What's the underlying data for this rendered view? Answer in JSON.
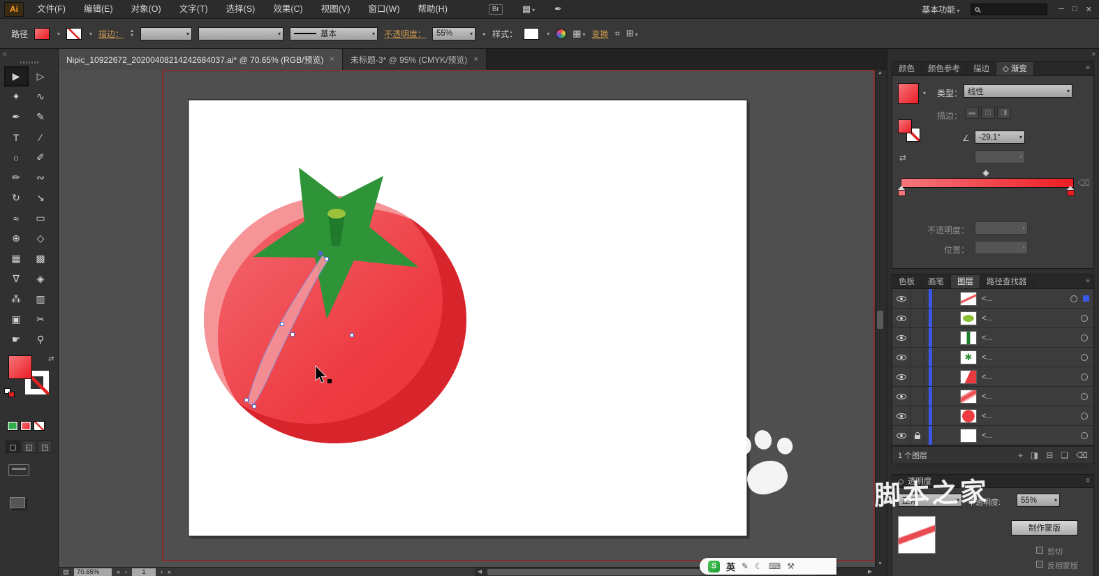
{
  "titlebar": {
    "logo": "Ai",
    "menus": [
      "文件(F)",
      "编辑(E)",
      "对象(O)",
      "文字(T)",
      "选择(S)",
      "效果(C)",
      "视图(V)",
      "窗口(W)",
      "帮助(H)"
    ],
    "bridge": "Br",
    "arrange_icon": "▦",
    "cslive_icon": "✒",
    "workspace": "基本功能",
    "window": {
      "minimize": "─",
      "restore": "□",
      "close": "✕"
    }
  },
  "control_bar": {
    "selection_type": "路径",
    "stroke_link": "描边：",
    "stroke_style": "基本",
    "opacity_link": "不透明度：",
    "opacity_value": "55%",
    "style_label": "样式：",
    "transform_link": "变换",
    "align_icon": "▦",
    "transform_grid_icon": "⌗",
    "more_icon": "⊞"
  },
  "document_tabs": [
    {
      "title": "Nipic_10922672_20200408214242684037.ai* @ 70.65% (RGB/预览)",
      "close": "×",
      "active": true
    },
    {
      "title": "未标题-3* @ 95% (CMYK/预览)",
      "close": "×",
      "active": false
    }
  ],
  "dock": {
    "collapse_left": "«",
    "collapse_right": "»",
    "panel_menu": "≡"
  },
  "tools": [
    {
      "name": "selection-tool",
      "glyph": "▶"
    },
    {
      "name": "direct-selection-tool",
      "glyph": "▷"
    },
    {
      "name": "magic-wand-tool",
      "glyph": "✦"
    },
    {
      "name": "lasso-tool",
      "glyph": "∿"
    },
    {
      "name": "pen-tool",
      "glyph": "✒"
    },
    {
      "name": "blob-brush-tool",
      "glyph": "✎"
    },
    {
      "name": "type-tool",
      "glyph": "T"
    },
    {
      "name": "line-segment-tool",
      "glyph": "∕"
    },
    {
      "name": "ellipse-tool",
      "glyph": "○"
    },
    {
      "name": "paintbrush-tool",
      "glyph": "✐"
    },
    {
      "name": "pencil-tool",
      "glyph": "✏"
    },
    {
      "name": "smooth-tool",
      "glyph": "∾"
    },
    {
      "name": "rotate-tool",
      "glyph": "↻"
    },
    {
      "name": "scale-tool",
      "glyph": "↘"
    },
    {
      "name": "width-tool",
      "glyph": "≈"
    },
    {
      "name": "free-transform-tool",
      "glyph": "▭"
    },
    {
      "name": "shape-builder-tool",
      "glyph": "⊕"
    },
    {
      "name": "perspective-grid-tool",
      "glyph": "◇"
    },
    {
      "name": "mesh-tool",
      "glyph": "▦"
    },
    {
      "name": "gradient-tool",
      "glyph": "▩"
    },
    {
      "name": "eyedropper-tool",
      "glyph": "∇"
    },
    {
      "name": "blend-tool",
      "glyph": "◈"
    },
    {
      "name": "symbol-sprayer-tool",
      "glyph": "⁂"
    },
    {
      "name": "column-graph-tool",
      "glyph": "▥"
    },
    {
      "name": "artboard-tool",
      "glyph": "▣"
    },
    {
      "name": "slice-tool",
      "glyph": "✂"
    },
    {
      "name": "hand-tool",
      "glyph": "☛"
    },
    {
      "name": "zoom-tool",
      "glyph": "⚲"
    }
  ],
  "toolbar_extras": {
    "swap_icon": "⇄",
    "draw_modes": [
      "▢",
      "◱",
      "◳"
    ],
    "fill_color_hint": "#ee3b41",
    "stroke_state": "none"
  },
  "gradient_panel": {
    "tabs": [
      "颜色",
      "颜色参考",
      "描边",
      "渐变"
    ],
    "panel_icon": "◇",
    "type_label": "类型：",
    "type_value": "线性",
    "stroke_label": "描边：",
    "stroke_buttons": [
      "▬",
      "◫",
      "◨"
    ],
    "angle_icon": "∠",
    "angle_value": "-29.1°",
    "reverse_icon": "⇄",
    "delete_stop_icon": "⌫",
    "opacity_label": "不透明度：",
    "location_label": "位置：",
    "stop_left": "#f4767b",
    "stop_right": "#ed1c24"
  },
  "layers_panel": {
    "tabs": [
      "色板",
      "画笔",
      "图层",
      "路径查找器"
    ],
    "rows": [
      {
        "thumb": "sliver",
        "label": "<...",
        "selected": true
      },
      {
        "thumb": "stem-top",
        "label": "<..."
      },
      {
        "thumb": "stem",
        "label": "<..."
      },
      {
        "thumb": "leaves",
        "label": "<..."
      },
      {
        "thumb": "shade",
        "label": "<..."
      },
      {
        "thumb": "highlight",
        "label": "<..."
      },
      {
        "thumb": "body",
        "label": "<..."
      },
      {
        "thumb": "blank",
        "label": "<...",
        "locked": true
      }
    ],
    "layer_color": "#3a57e8",
    "footer": "1 个图层",
    "footer_icons": [
      "⌖",
      "◨",
      "⊟",
      "❏",
      "⌫"
    ]
  },
  "transparency_panel": {
    "panel_icon": "◇",
    "title": "透明度",
    "menu_icon": "≡",
    "blend_mode": "正常",
    "opacity_label": "不透明度:",
    "opacity_value": "55%",
    "make_mask": "制作蒙版",
    "clip_label": "剪切",
    "invert_label": "反相蒙版"
  },
  "status_bar": {
    "zoom": "70.65%",
    "artboard": "1",
    "nav_first": "«",
    "nav_prev": "‹",
    "nav_next": "›",
    "nav_last": "»",
    "doc_icon": "▤"
  },
  "canvas": {
    "watermark": "脚本之家"
  },
  "ime": {
    "logo": "S",
    "mode": "英",
    "icons": [
      "✎",
      "☾",
      "⌨",
      "⚒"
    ]
  }
}
